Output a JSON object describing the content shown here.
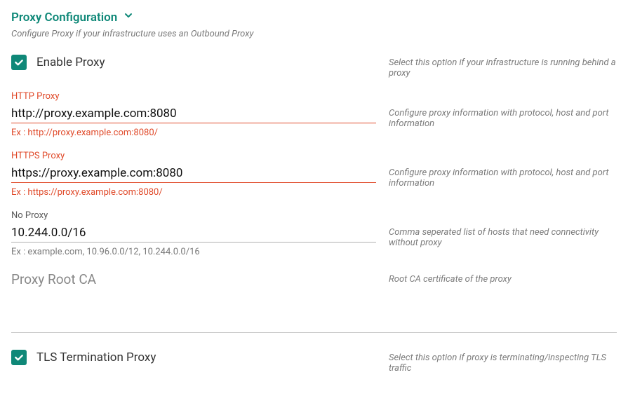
{
  "section": {
    "title": "Proxy Configuration",
    "subtitle": "Configure Proxy if your infrastructure uses an Outbound Proxy"
  },
  "enable_proxy": {
    "label": "Enable Proxy",
    "help": "Select this option if your infrastructure is running behind a proxy"
  },
  "http_proxy": {
    "label": "HTTP Proxy",
    "value": "http://proxy.example.com:8080",
    "example": "Ex : http://proxy.example.com:8080/",
    "help": "Configure proxy information with protocol, host and port information"
  },
  "https_proxy": {
    "label": "HTTPS Proxy",
    "value": "https://proxy.example.com:8080",
    "example": "Ex : https://proxy.example.com:8080/",
    "help": "Configure proxy information with protocol, host and port information"
  },
  "no_proxy": {
    "label": "No Proxy",
    "value": "10.244.0.0/16",
    "example": "Ex : example.com, 10.96.0.0/12, 10.244.0.0/16",
    "help": "Comma seperated list of hosts that need connectivity without proxy"
  },
  "root_ca": {
    "label": "Proxy Root CA",
    "help": "Root CA certificate of the proxy"
  },
  "tls_proxy": {
    "label": "TLS Termination Proxy",
    "help": "Select this option if proxy is terminating/inspecting TLS traffic"
  }
}
